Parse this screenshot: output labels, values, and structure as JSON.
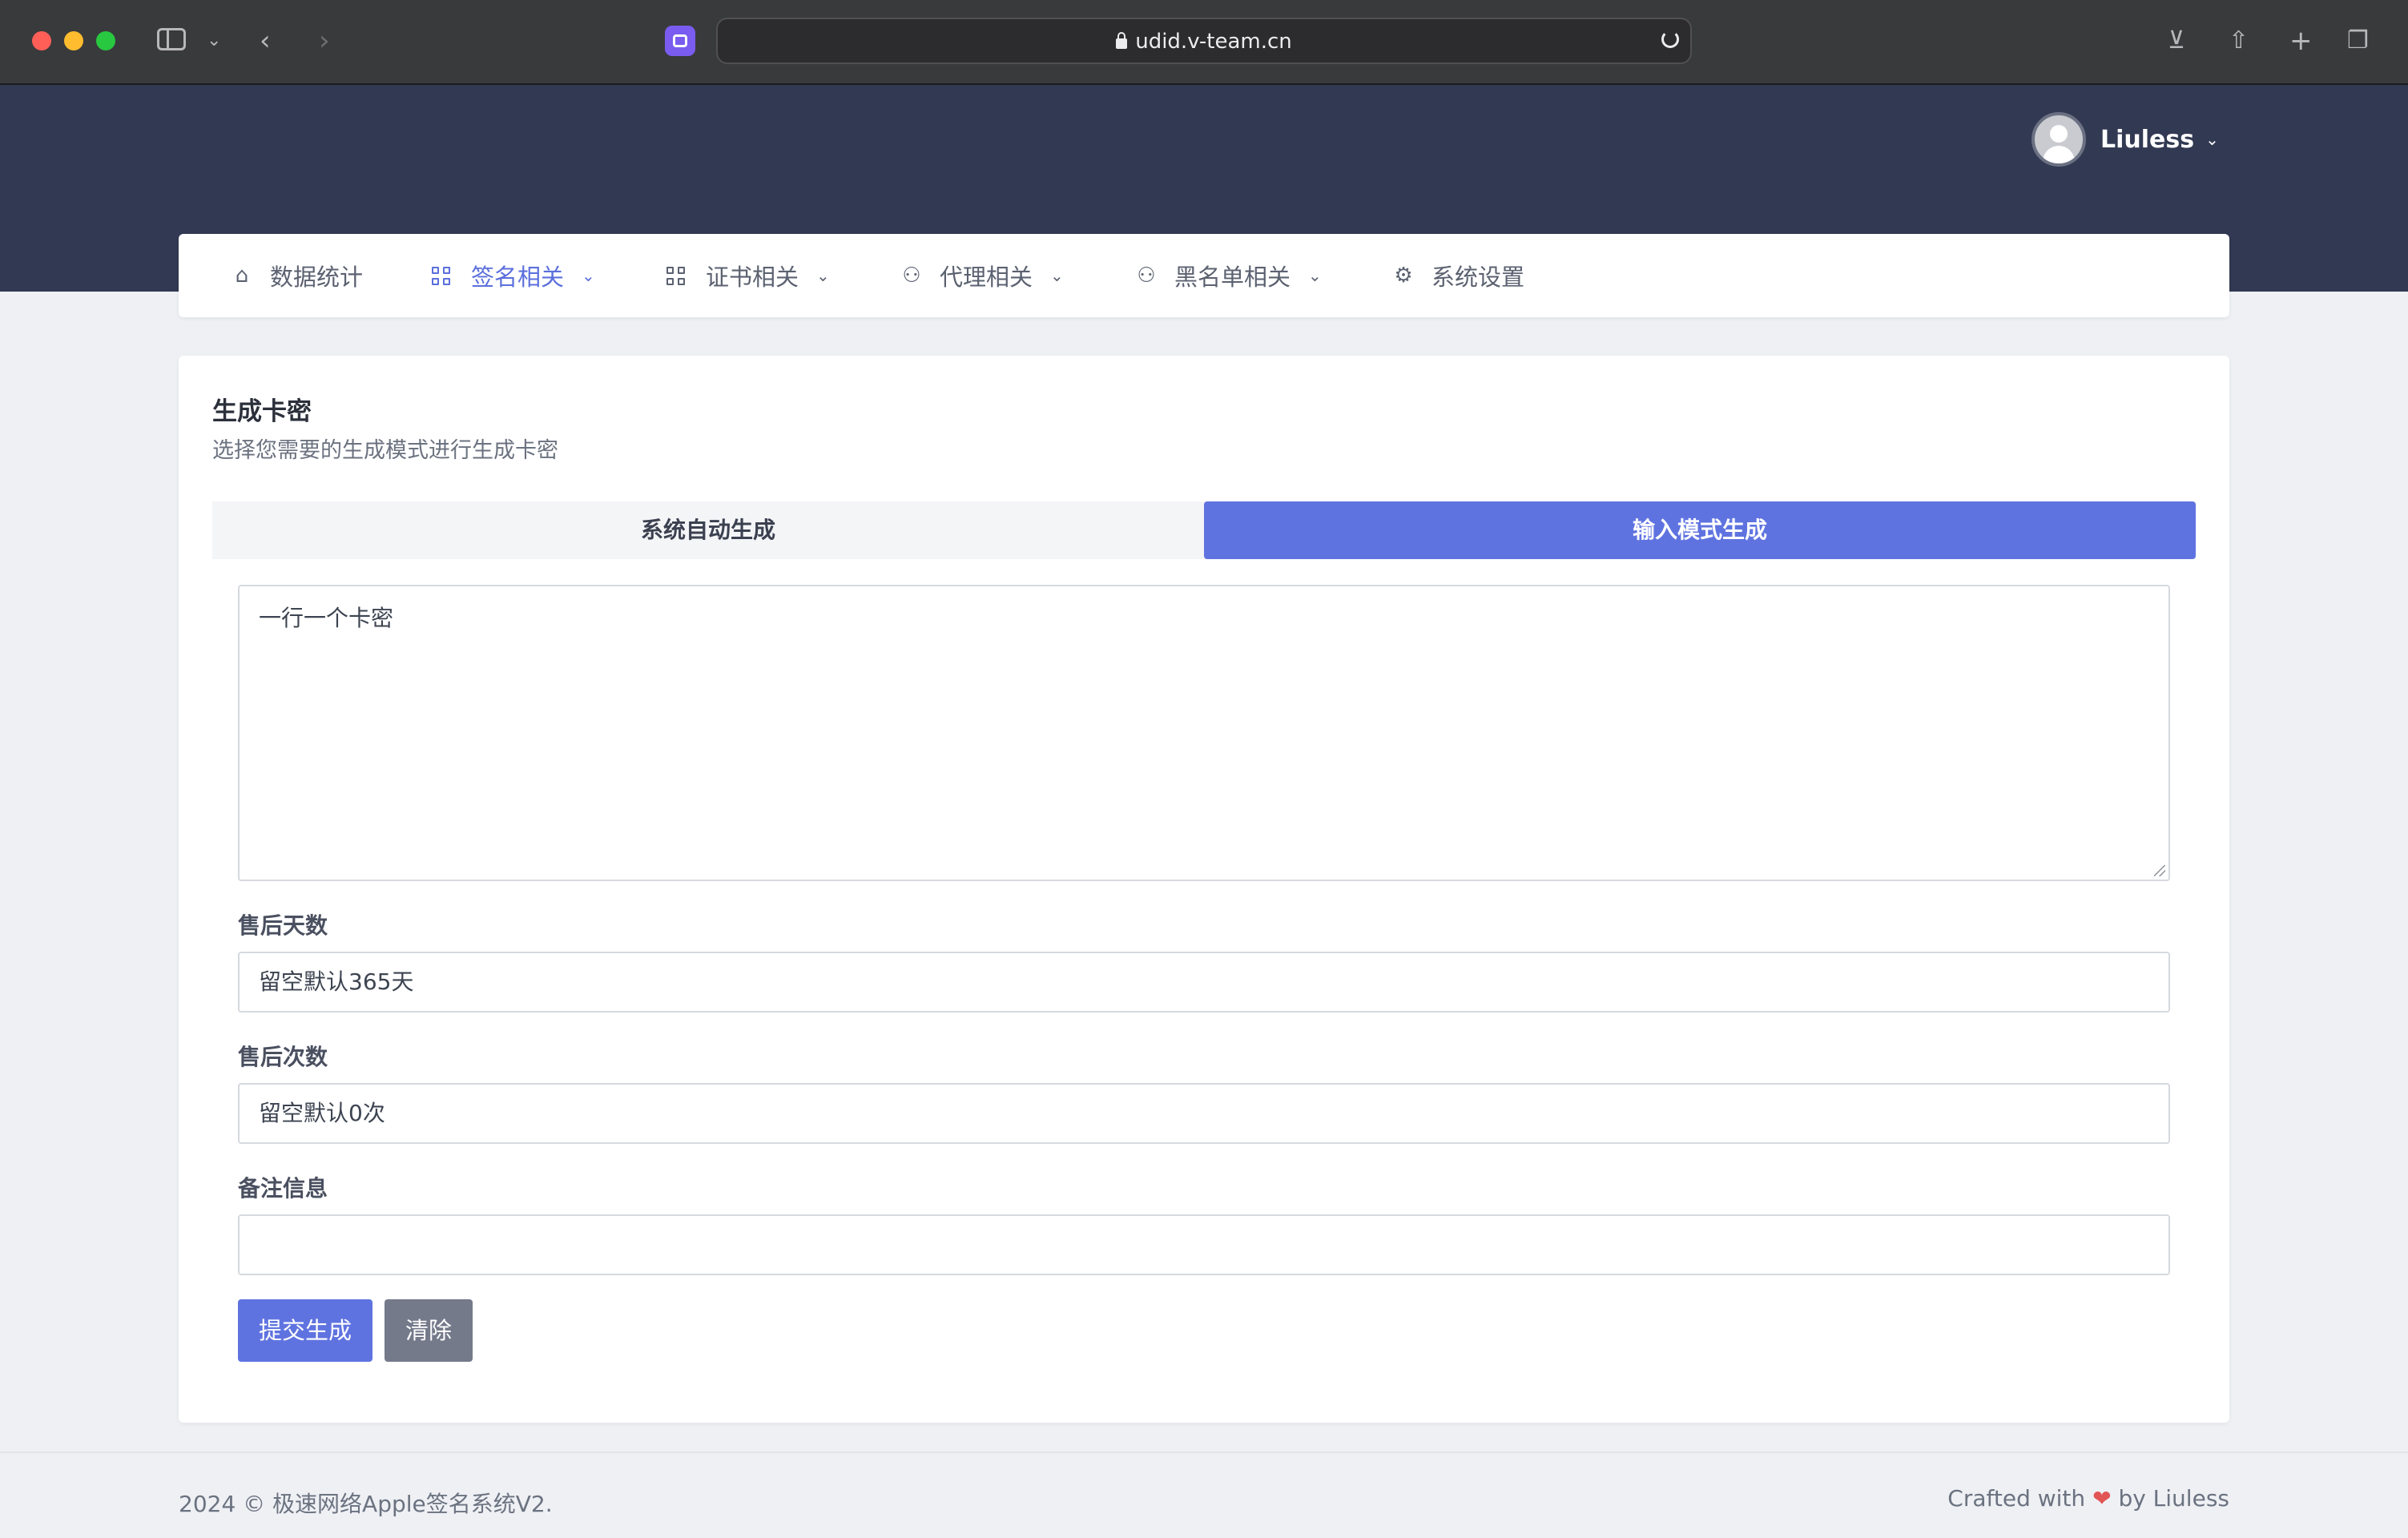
{
  "browser": {
    "url": "udid.v-team.cn"
  },
  "header": {
    "user_name": "Liuless"
  },
  "nav": {
    "items": [
      {
        "label": "数据统计",
        "icon": "home-icon",
        "has_dropdown": false,
        "active": false
      },
      {
        "label": "签名相关",
        "icon": "grid-icon",
        "has_dropdown": true,
        "active": true
      },
      {
        "label": "证书相关",
        "icon": "grid-icon",
        "has_dropdown": true,
        "active": false
      },
      {
        "label": "代理相关",
        "icon": "users-icon",
        "has_dropdown": true,
        "active": false
      },
      {
        "label": "黑名单相关",
        "icon": "users-icon",
        "has_dropdown": true,
        "active": false
      },
      {
        "label": "系统设置",
        "icon": "gear-icon",
        "has_dropdown": false,
        "active": false
      }
    ]
  },
  "card": {
    "title": "生成卡密",
    "subtitle": "选择您需要的生成模式进行生成卡密",
    "tabs": [
      {
        "label": "系统自动生成",
        "active": false
      },
      {
        "label": "输入模式生成",
        "active": true
      }
    ],
    "textarea_placeholder": "一行一个卡密",
    "fields": [
      {
        "label": "售后天数",
        "placeholder": "留空默认365天"
      },
      {
        "label": "售后次数",
        "placeholder": "留空默认0次"
      },
      {
        "label": "备注信息",
        "placeholder": ""
      }
    ],
    "submit_label": "提交生成",
    "clear_label": "清除"
  },
  "footer": {
    "left": "2024 © 极速网络Apple签名系统V2.",
    "right_prefix": "Crafted with",
    "right_suffix": "by Liuless"
  },
  "colors": {
    "header_band": "#323952",
    "accent": "#5f73e0",
    "clear_button": "#747a8a",
    "heart": "#e25555"
  }
}
